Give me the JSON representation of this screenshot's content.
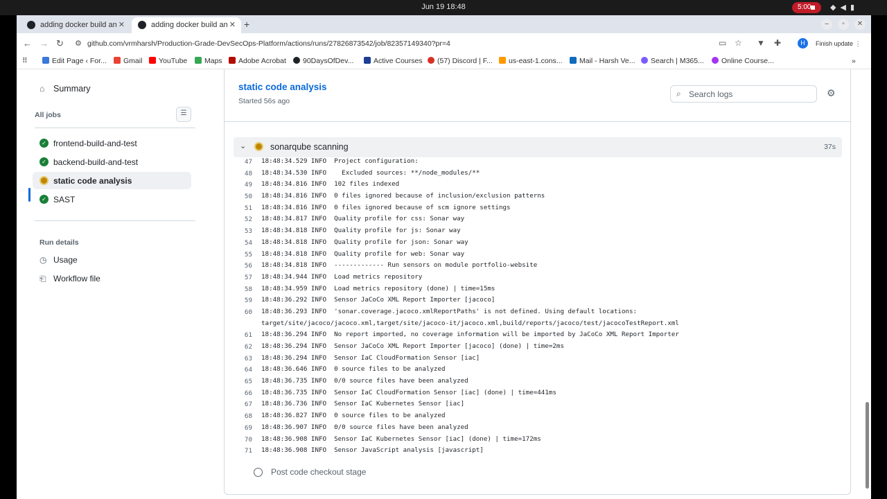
{
  "os": {
    "clock": "Jun 19  18:48",
    "rec_time": "5:00"
  },
  "browser": {
    "tabs": [
      {
        "title": "adding docker build and"
      },
      {
        "title": "adding docker build and"
      }
    ],
    "url": "github.com/vrmharsh/Production-Grade-DevSecOps-Platform/actions/runs/27826873542/job/82357149340?pr=4",
    "avatar_letter": "H",
    "finish_update": "Finish update",
    "bookmarks": [
      {
        "label": "Edit Page ‹ For...",
        "color": "#3c78d8"
      },
      {
        "label": "Gmail",
        "color": "#ea4335"
      },
      {
        "label": "YouTube",
        "color": "#ff0000"
      },
      {
        "label": "Maps",
        "color": "#34a853"
      },
      {
        "label": "Adobe Acrobat",
        "color": "#b30b00"
      },
      {
        "label": "90DaysOfDev...",
        "color": "#1f2328"
      },
      {
        "label": "Active Courses",
        "color": "#1c3f94"
      },
      {
        "label": "(57) Discord | F...",
        "color": "#d93025"
      },
      {
        "label": "us-east-1.cons...",
        "color": "#ff9900"
      },
      {
        "label": "Mail - Harsh Ve...",
        "color": "#0f6cbd"
      },
      {
        "label": "Search | M365...",
        "color": "#7b5cff"
      },
      {
        "label": "Online Course...",
        "color": "#a435f0"
      }
    ]
  },
  "sidebar": {
    "summary": "Summary",
    "all_jobs": "All jobs",
    "jobs": [
      {
        "label": "frontend-build-and-test",
        "status": "success"
      },
      {
        "label": "backend-build-and-test",
        "status": "success"
      },
      {
        "label": "static code analysis",
        "status": "in_progress"
      },
      {
        "label": "SAST",
        "status": "success"
      }
    ],
    "run_details": "Run details",
    "usage": "Usage",
    "workflow_file": "Workflow file"
  },
  "job": {
    "title": "static code analysis",
    "started": "Started 56s ago",
    "search_placeholder": "Search logs"
  },
  "step": {
    "name": "sonarqube scanning",
    "duration": "37s",
    "next_step": "Post code checkout stage"
  },
  "log_lines": [
    {
      "n": "47",
      "text": "18:48:34.529 INFO  Project configuration:"
    },
    {
      "n": "48",
      "text": "18:48:34.530 INFO    Excluded sources: **/node_modules/**"
    },
    {
      "n": "49",
      "text": "18:48:34.816 INFO  102 files indexed"
    },
    {
      "n": "50",
      "text": "18:48:34.816 INFO  0 files ignored because of inclusion/exclusion patterns"
    },
    {
      "n": "51",
      "text": "18:48:34.816 INFO  0 files ignored because of scm ignore settings"
    },
    {
      "n": "52",
      "text": "18:48:34.817 INFO  Quality profile for css: Sonar way"
    },
    {
      "n": "53",
      "text": "18:48:34.818 INFO  Quality profile for js: Sonar way"
    },
    {
      "n": "54",
      "text": "18:48:34.818 INFO  Quality profile for json: Sonar way"
    },
    {
      "n": "55",
      "text": "18:48:34.818 INFO  Quality profile for web: Sonar way"
    },
    {
      "n": "56",
      "text": "18:48:34.818 INFO  ------------- Run sensors on module portfolio-website"
    },
    {
      "n": "57",
      "text": "18:48:34.944 INFO  Load metrics repository"
    },
    {
      "n": "58",
      "text": "18:48:34.959 INFO  Load metrics repository (done) | time=15ms"
    },
    {
      "n": "59",
      "text": "18:48:36.292 INFO  Sensor JaCoCo XML Report Importer [jacoco]"
    },
    {
      "n": "60",
      "text": "18:48:36.293 INFO  'sonar.coverage.jacoco.xmlReportPaths' is not defined. Using default locations:\ntarget/site/jacoco/jacoco.xml,target/site/jacoco-it/jacoco.xml,build/reports/jacoco/test/jacocoTestReport.xml"
    },
    {
      "n": "61",
      "text": "18:48:36.294 INFO  No report imported, no coverage information will be imported by JaCoCo XML Report Importer"
    },
    {
      "n": "62",
      "text": "18:48:36.294 INFO  Sensor JaCoCo XML Report Importer [jacoco] (done) | time=2ms"
    },
    {
      "n": "63",
      "text": "18:48:36.294 INFO  Sensor IaC CloudFormation Sensor [iac]"
    },
    {
      "n": "64",
      "text": "18:48:36.646 INFO  0 source files to be analyzed"
    },
    {
      "n": "65",
      "text": "18:48:36.735 INFO  0/0 source files have been analyzed"
    },
    {
      "n": "66",
      "text": "18:48:36.735 INFO  Sensor IaC CloudFormation Sensor [iac] (done) | time=441ms"
    },
    {
      "n": "67",
      "text": "18:48:36.736 INFO  Sensor IaC Kubernetes Sensor [iac]"
    },
    {
      "n": "68",
      "text": "18:48:36.827 INFO  0 source files to be analyzed"
    },
    {
      "n": "69",
      "text": "18:48:36.907 INFO  0/0 source files have been analyzed"
    },
    {
      "n": "70",
      "text": "18:48:36.908 INFO  Sensor IaC Kubernetes Sensor [iac] (done) | time=172ms"
    },
    {
      "n": "71",
      "text": "18:48:36.908 INFO  Sensor JavaScript analysis [javascript]"
    }
  ],
  "colors": {
    "accent": "#0969da",
    "success": "#1a7f37",
    "running": "#bf8700"
  }
}
